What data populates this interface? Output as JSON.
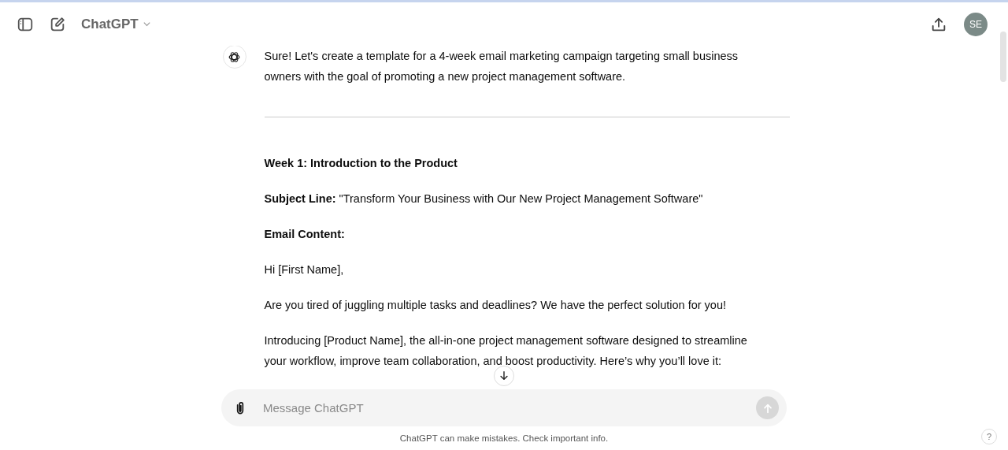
{
  "header": {
    "title": "ChatGPT",
    "avatar": "SE"
  },
  "message": {
    "blocks": [
      {
        "kind": "paragraph",
        "text": "Sure! Let's create a template for a 4-week email marketing campaign targeting small business owners with the goal of promoting a new project management software."
      },
      {
        "kind": "rule"
      },
      {
        "kind": "heading",
        "text": "Week 1: Introduction to the Product"
      },
      {
        "kind": "paragraph",
        "text": "**Subject Line:** \"Transform Your Business with Our New Project Management Software\""
      },
      {
        "kind": "heading",
        "text": "Email Content:"
      },
      {
        "kind": "paragraph",
        "text": "Hi [First Name],"
      },
      {
        "kind": "paragraph",
        "text": "Are you tired of juggling multiple tasks and deadlines? We have the perfect solution for you!"
      },
      {
        "kind": "paragraph",
        "text": "Introducing [Product Name], the all-in-one project management software designed to streamline your workflow, improve team collaboration, and boost productivity. Here’s why you’ll love it:"
      }
    ]
  },
  "composer": {
    "placeholder": "Message ChatGPT"
  },
  "footer": "ChatGPT can make mistakes. Check important info.",
  "help": "?"
}
